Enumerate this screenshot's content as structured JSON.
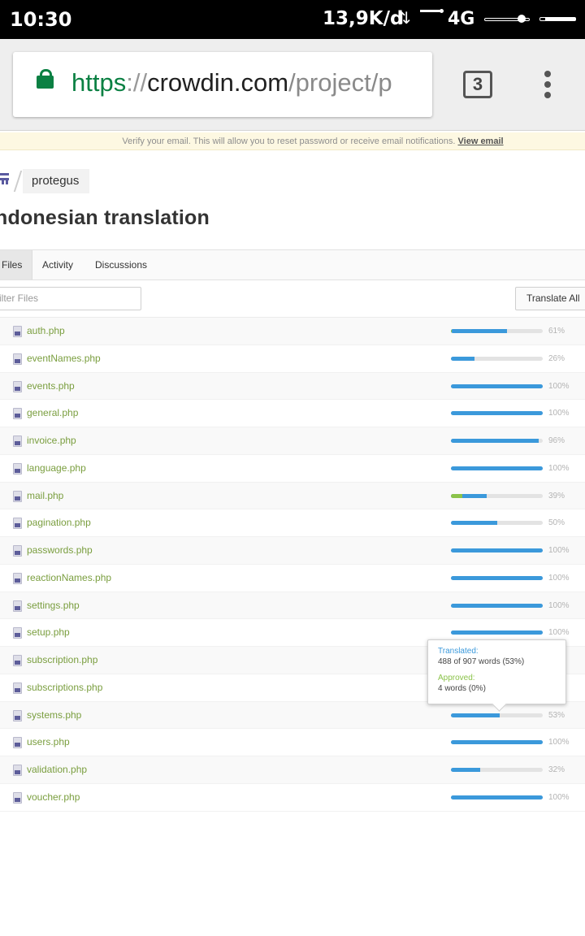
{
  "status_bar": {
    "time": "10:30",
    "speed": "13,9K/d",
    "data_icon": "⇅",
    "network": "4G"
  },
  "browser": {
    "url_scheme": "https",
    "url_sep": "://",
    "url_host": "crowdin.com",
    "url_path": "/project/p",
    "tab_count": "3"
  },
  "banner": {
    "text": "Verify your email. This will allow you to reset password or receive email notifications.",
    "link": "View email"
  },
  "breadcrumb": {
    "project": "protegus"
  },
  "page": {
    "title": "ndonesian translation"
  },
  "tabs": [
    {
      "label": "Files"
    },
    {
      "label": "Activity"
    },
    {
      "label": "Discussions"
    }
  ],
  "filter": {
    "placeholder": "Filter Files",
    "display": "ilter Files"
  },
  "translate_all": "Translate All",
  "files": [
    {
      "name": "auth.php",
      "translated": 0.61,
      "approved": 0.01,
      "pct": "61%"
    },
    {
      "name": "eventNames.php",
      "translated": 0.26,
      "approved": 0,
      "pct": "26%"
    },
    {
      "name": "events.php",
      "translated": 1.0,
      "approved": 0,
      "pct": "100%"
    },
    {
      "name": "general.php",
      "translated": 1.0,
      "approved": 0,
      "pct": "100%"
    },
    {
      "name": "invoice.php",
      "translated": 0.96,
      "approved": 0,
      "pct": "96%"
    },
    {
      "name": "language.php",
      "translated": 1.0,
      "approved": 0,
      "pct": "100%"
    },
    {
      "name": "mail.php",
      "translated": 0.39,
      "approved": 0.12,
      "pct": "39%"
    },
    {
      "name": "pagination.php",
      "translated": 0.5,
      "approved": 0,
      "pct": "50%"
    },
    {
      "name": "passwords.php",
      "translated": 1.0,
      "approved": 0,
      "pct": "100%"
    },
    {
      "name": "reactionNames.php",
      "translated": 1.0,
      "approved": 0,
      "pct": "100%"
    },
    {
      "name": "settings.php",
      "translated": 1.0,
      "approved": 0,
      "pct": "100%"
    },
    {
      "name": "setup.php",
      "translated": 1.0,
      "approved": 0,
      "pct": "100%"
    },
    {
      "name": "subscription.php",
      "translated": 1.0,
      "approved": 0,
      "pct": ""
    },
    {
      "name": "subscriptions.php",
      "translated": 1.0,
      "approved": 0,
      "pct": ""
    },
    {
      "name": "systems.php",
      "translated": 0.53,
      "approved": 0,
      "pct": "53%"
    },
    {
      "name": "users.php",
      "translated": 1.0,
      "approved": 0,
      "pct": "100%"
    },
    {
      "name": "validation.php",
      "translated": 0.32,
      "approved": 0,
      "pct": "32%"
    },
    {
      "name": "voucher.php",
      "translated": 1.0,
      "approved": 0,
      "pct": "100%"
    }
  ],
  "tooltip": {
    "translated_label": "Translated:",
    "translated_value": "488 of 907 words (53%)",
    "approved_label": "Approved:",
    "approved_value": "4 words (0%)"
  },
  "colors": {
    "translated": "#3b99db",
    "approved": "#8bc34a",
    "file_link": "#7a9e3f",
    "secure_green": "#0b8043"
  },
  "icons": {
    "lock": "lock-icon",
    "file": "php-file-icon",
    "project": "project-icon",
    "menu": "more-vert-icon"
  }
}
